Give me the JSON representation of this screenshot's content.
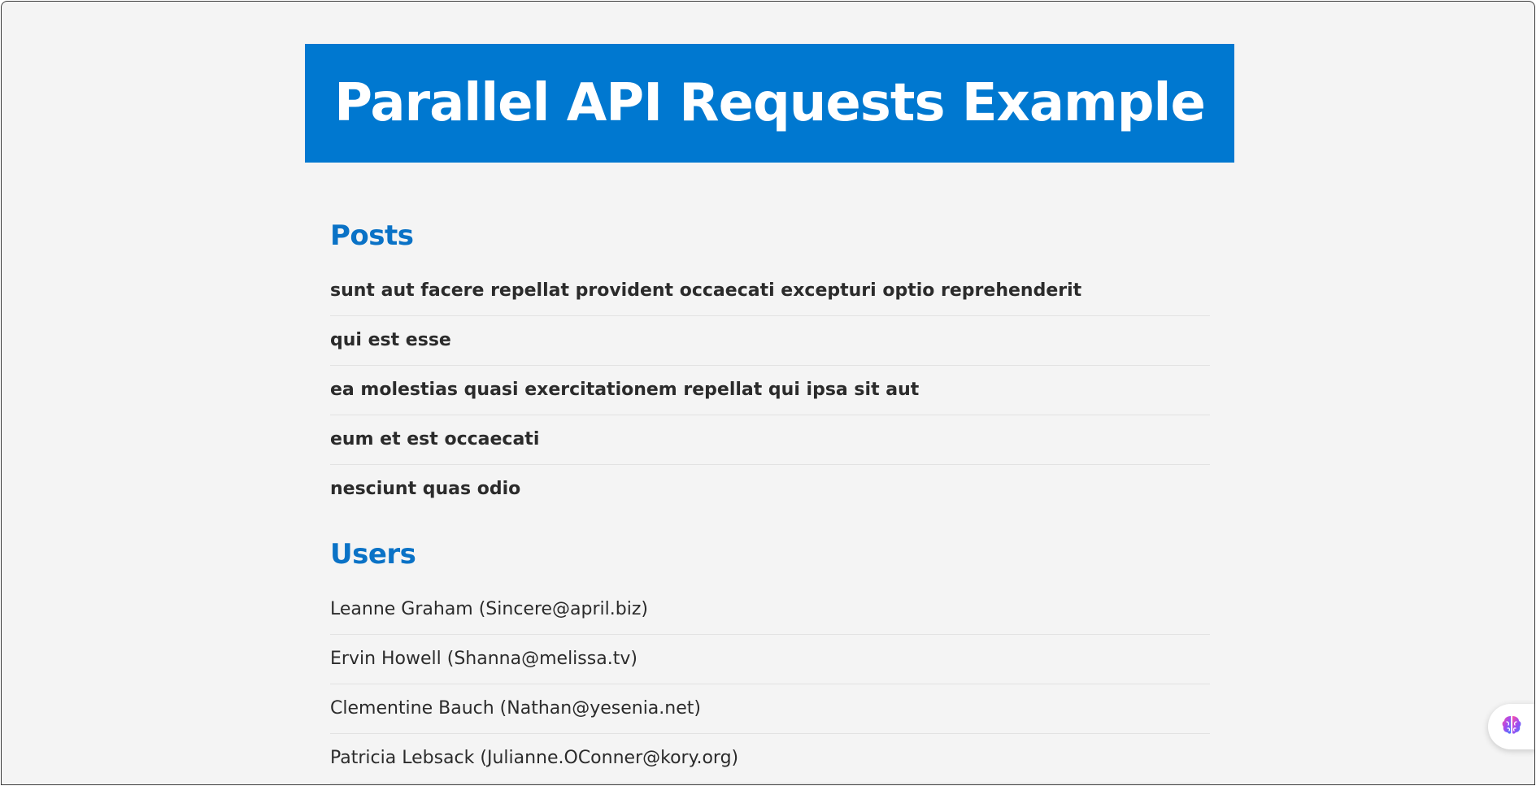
{
  "header": {
    "title": "Parallel API Requests Example"
  },
  "posts": {
    "heading": "Posts",
    "items": [
      "sunt aut facere repellat provident occaecati excepturi optio reprehenderit",
      "qui est esse",
      "ea molestias quasi exercitationem repellat qui ipsa sit aut",
      "eum et est occaecati",
      "nesciunt quas odio"
    ]
  },
  "users": {
    "heading": "Users",
    "items": [
      "Leanne Graham (Sincere@april.biz)",
      "Ervin Howell (Shanna@melissa.tv)",
      "Clementine Bauch (Nathan@yesenia.net)",
      "Patricia Lebsack (Julianne.OConner@kory.org)"
    ]
  },
  "floating_button": {
    "icon": "brain-icon"
  },
  "colors": {
    "accent": "#0078d0",
    "heading": "#0a72c6",
    "background": "#f4f4f4",
    "text": "#2b2b2b"
  }
}
